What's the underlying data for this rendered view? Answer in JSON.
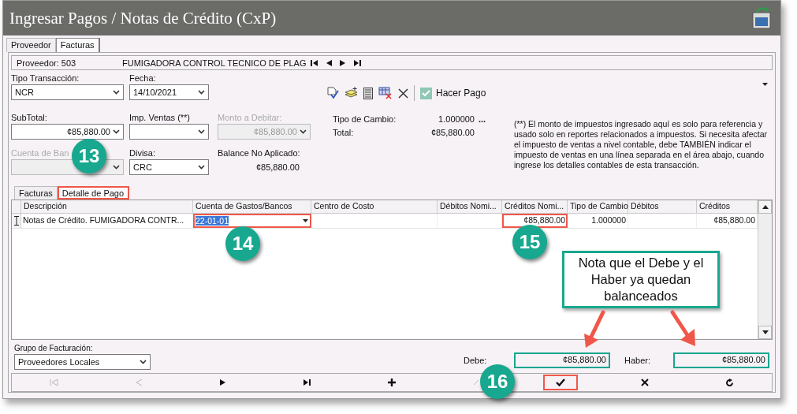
{
  "window": {
    "title": "Ingresar Pagos / Notas de Crédito (CxP)"
  },
  "tabs": [
    {
      "label": "Proveedor",
      "selected": false
    },
    {
      "label": "Facturas",
      "selected": true
    }
  ],
  "provider": {
    "label": "Proveedor: 503",
    "name": "FUMIGADORA CONTROL TECNICO DE PLAG"
  },
  "form": {
    "tipo_transaccion": {
      "label": "Tipo Transacción:",
      "value": "NCR",
      "disabled": false
    },
    "fecha": {
      "label": "Fecha:",
      "value": "14/10/2021",
      "disabled": false
    },
    "subtotal": {
      "label": "SubTotal:",
      "value": "¢85,880.00",
      "disabled": false
    },
    "imp_ventas": {
      "label": "Imp. Ventas (**)",
      "disabled": false
    },
    "monto_a_debitar": {
      "label": "Monto a Debitar:",
      "value": "¢85,880.00",
      "disabled": true
    },
    "cuenta_de_banco": {
      "label": "Cuenta de Ban",
      "disabled": true
    },
    "divisa": {
      "label": "Divisa:",
      "value": "CRC",
      "disabled": false
    },
    "balance": {
      "label": "Balance No Aplicado:",
      "value": "¢85,880.00"
    },
    "tipo_de_cambio": {
      "label": "Tipo de Cambio:",
      "value": "1.000000",
      "button": "..."
    },
    "total": {
      "label": "Total:",
      "value": "¢85,880.00"
    },
    "note": "(**) El monto de impuestos ingresado aquí es solo para referencia y usado solo en reportes relacionados a impuestos. Si necesita afectar el impuesto de ventas a nivel contable, debe TAMBIÉN indicar el impuesto de ventas en una línea separada en el área abajo, cuando ingrese los detalles contables de esta transacción."
  },
  "toolbar": {
    "hacer_pago": {
      "label": "Hacer Pago",
      "checked": true
    }
  },
  "detail_tabs": [
    {
      "label": "Facturas",
      "selected": false
    },
    {
      "label": "Detalle de Pago",
      "selected": true,
      "highlighted": true
    }
  ],
  "table": {
    "columns": [
      "Descripción",
      "Cuenta de Gastos/Bancos",
      "Centro de Costo",
      "Débitos Nomi...",
      "Créditos Nomi...",
      "Tipo de Cambio",
      "Débitos",
      "Créditos"
    ],
    "rows": [
      {
        "cells": [
          {
            "kind": "text",
            "text": "Notas de Crédito. FUMIGADORA CONTR..."
          },
          {
            "kind": "combo",
            "text": "22-01-01",
            "highlighted": true
          },
          {
            "kind": "empty"
          },
          {
            "kind": "empty"
          },
          {
            "kind": "text",
            "text": "¢85,880.00",
            "highlighted": true
          },
          {
            "kind": "text",
            "text": "1.000000"
          },
          {
            "kind": "empty"
          },
          {
            "kind": "text",
            "text": "¢85,880.00"
          }
        ]
      }
    ]
  },
  "grupo_facturacion": {
    "label": "Grupo de Facturación:",
    "value": "Proveedores Locales"
  },
  "debe": {
    "label": "Debe:",
    "value": "¢85,880.00",
    "highlighted": true
  },
  "haber": {
    "label": "Haber:",
    "value": "¢85,880.00",
    "highlighted": true
  },
  "nav_buttons": [
    {
      "kind": "first",
      "disabled": true
    },
    {
      "kind": "prev",
      "disabled": true
    },
    {
      "kind": "next",
      "disabled": false
    },
    {
      "kind": "last",
      "disabled": false
    },
    {
      "kind": "add",
      "disabled": false
    },
    {
      "kind": "edit",
      "disabled": true
    },
    {
      "kind": "save",
      "disabled": false,
      "highlighted": true
    },
    {
      "kind": "cancel",
      "disabled": false
    },
    {
      "kind": "refresh",
      "disabled": false
    }
  ],
  "annotations": [
    {
      "kind": "badge",
      "text": "13"
    },
    {
      "kind": "badge",
      "text": "14"
    },
    {
      "kind": "badge",
      "text": "15"
    },
    {
      "kind": "badge",
      "text": "16"
    },
    {
      "kind": "callout",
      "text": "Nota que el Debe y el Haber ya quedan balanceados"
    }
  ]
}
